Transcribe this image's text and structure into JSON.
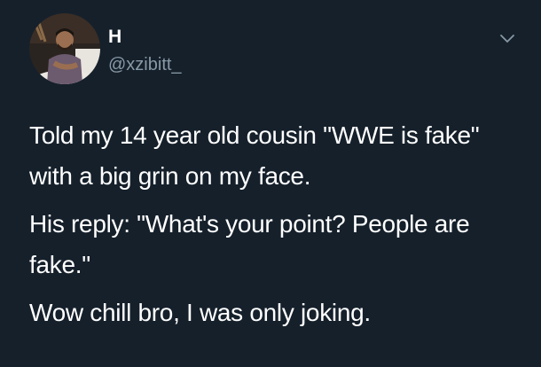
{
  "user": {
    "display_name": "H",
    "handle": "@xzibitt_"
  },
  "tweet": {
    "paragraphs": [
      "Told my 14 year old cousin \"WWE is fake\" with a big grin on my face.",
      "His reply: \"What's your point? People are fake.\"",
      "Wow chill bro, I was only joking."
    ]
  },
  "icons": {
    "menu": "chevron-down-icon",
    "avatar": "avatar"
  },
  "colors": {
    "background": "#15202b",
    "text": "#ffffff",
    "secondary_text": "#8899a6"
  }
}
